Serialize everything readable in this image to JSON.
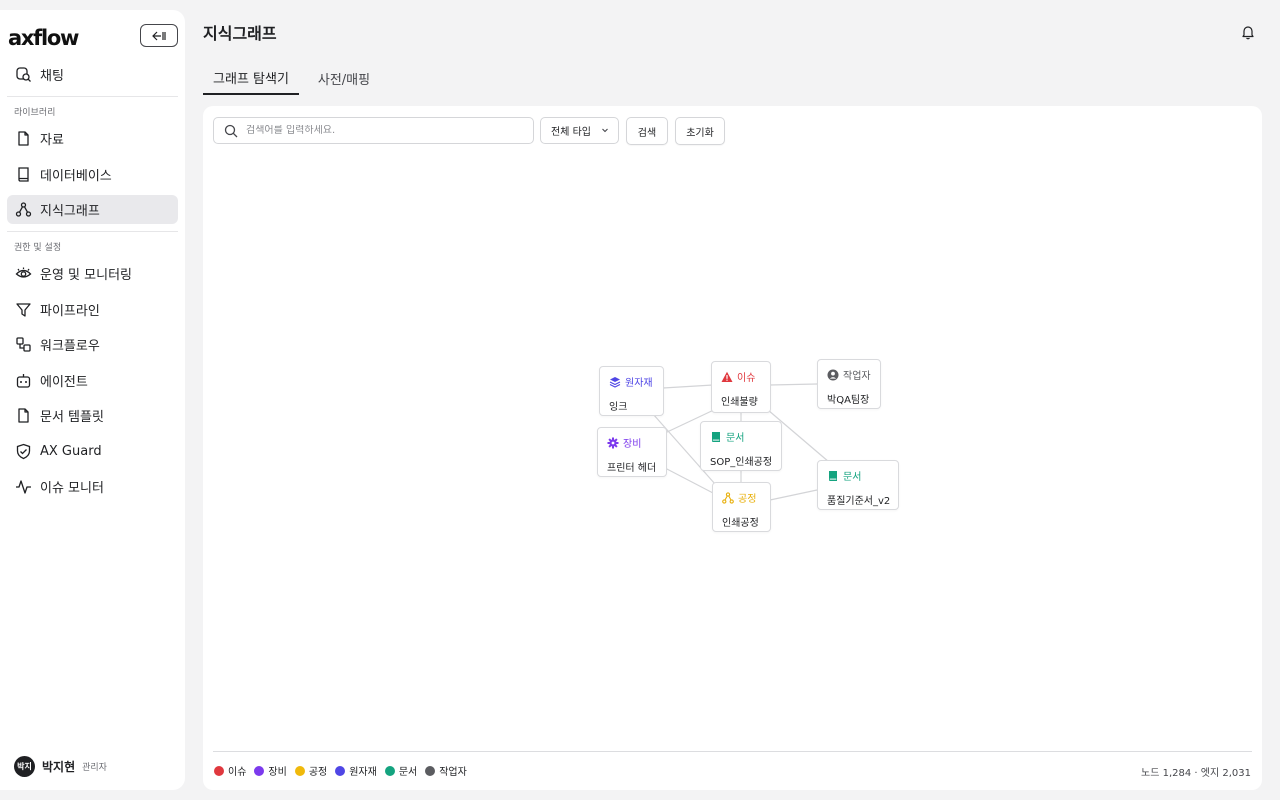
{
  "brand": {
    "logo_text": "axflow"
  },
  "sidebar": {
    "chat": "채팅",
    "section_library": "라이브러리",
    "library_items": [
      "자료",
      "데이터베이스",
      "지식그래프"
    ],
    "section_settings": "권한 및 설정",
    "settings_items": [
      "운영 및 모니터링",
      "파이프라인",
      "워크플로우",
      "에이전트",
      "문서 템플릿",
      "AX Guard",
      "이슈 모니터"
    ],
    "user": {
      "avatar": "박지",
      "name": "박지현",
      "role": "관리자"
    }
  },
  "header": {
    "title": "지식그래프"
  },
  "tabs": [
    {
      "label": "그래프 탐색기",
      "active": true
    },
    {
      "label": "사전/매핑",
      "active": false
    }
  ],
  "toolbar": {
    "search_placeholder": "검색어를 입력하세요.",
    "type_filter": "전체 타입",
    "search_button": "검색",
    "reset_button": "초기화"
  },
  "graph": {
    "nodes": [
      {
        "id": "ink",
        "type": "원자재",
        "label": "잉크",
        "icon": "layers-icon",
        "color": "#4f46e5"
      },
      {
        "id": "defect",
        "type": "이슈",
        "label": "인쇄불량",
        "icon": "warning-icon",
        "color": "#e0383e"
      },
      {
        "id": "author",
        "type": "작업자",
        "label": "박QA팀장",
        "icon": "user-circle-icon",
        "color": "#6b6c72"
      },
      {
        "id": "printhead",
        "type": "장비",
        "label": "프린터 헤더",
        "icon": "gear-icon",
        "color": "#7c3aed"
      },
      {
        "id": "sop",
        "type": "문서",
        "label": "SOP_인쇄공정",
        "icon": "book-icon",
        "color": "#14a37f"
      },
      {
        "id": "quality",
        "type": "문서",
        "label": "품질기준서_v2",
        "icon": "book-icon",
        "color": "#14a37f"
      },
      {
        "id": "process",
        "type": "공정",
        "label": "인쇄공정",
        "icon": "process-icon",
        "color": "#e8b00c"
      }
    ],
    "edges": [
      [
        "ink",
        "defect"
      ],
      [
        "defect",
        "author"
      ],
      [
        "ink",
        "process"
      ],
      [
        "printhead",
        "defect"
      ],
      [
        "printhead",
        "process"
      ],
      [
        "defect",
        "sop"
      ],
      [
        "sop",
        "process"
      ],
      [
        "defect",
        "quality"
      ],
      [
        "process",
        "quality"
      ]
    ]
  },
  "legend": [
    {
      "label": "이슈",
      "color": "#e0383e"
    },
    {
      "label": "장비",
      "color": "#7c3aed"
    },
    {
      "label": "공정",
      "color": "#f0b90b"
    },
    {
      "label": "원자재",
      "color": "#4f46e5"
    },
    {
      "label": "문서",
      "color": "#14a37f"
    },
    {
      "label": "작업자",
      "color": "#5b5c60"
    }
  ],
  "stats": "노드 1,284 · 엣지 2,031"
}
